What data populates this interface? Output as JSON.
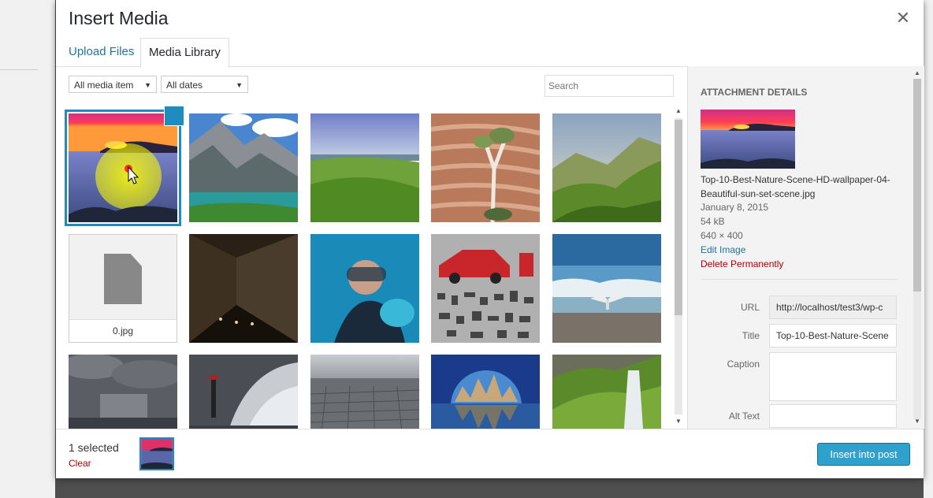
{
  "modal": {
    "title": "Insert Media",
    "close_icon": "close-icon"
  },
  "tabs": [
    {
      "label": "Upload Files"
    },
    {
      "label": "Media Library"
    }
  ],
  "toolbar": {
    "filter_type": "All media item",
    "filter_date": "All dates",
    "search_placeholder": "Search"
  },
  "grid": {
    "items": [
      {
        "kind": "sunset",
        "selected": true
      },
      {
        "kind": "mountain-lake"
      },
      {
        "kind": "green-field"
      },
      {
        "kind": "rock-tree"
      },
      {
        "kind": "green-hills"
      },
      {
        "kind": "file",
        "filename": "0.jpg"
      },
      {
        "kind": "dark-tunnel"
      },
      {
        "kind": "diver"
      },
      {
        "kind": "car-parts"
      },
      {
        "kind": "beach-bird"
      },
      {
        "kind": "storm-sky"
      },
      {
        "kind": "lighthouse-wave"
      },
      {
        "kind": "aerial-city"
      },
      {
        "kind": "city-sphere"
      },
      {
        "kind": "waterfall"
      }
    ]
  },
  "sidebar": {
    "heading": "Attachment Details",
    "filename": "Top-10-Best-Nature-Scene-HD-wallpaper-04-Beautiful-sun-set-scene.jpg",
    "date": "January 8, 2015",
    "size": "54 kB",
    "dimensions": "640 × 400",
    "edit_link": "Edit Image",
    "delete_link": "Delete Permanently",
    "fields": {
      "url_label": "URL",
      "url_value": "http://localhost/test3/wp-c",
      "title_label": "Title",
      "title_value": "Top-10-Best-Nature-Scene",
      "caption_label": "Caption",
      "alt_label": "Alt Text"
    }
  },
  "footer": {
    "selected_count": "1 selected",
    "clear_label": "Clear",
    "insert_label": "Insert into post"
  },
  "colors": {
    "accent": "#1e8cbe",
    "button": "#2ea2cc",
    "link": "#21759b",
    "danger": "#aa0000"
  }
}
